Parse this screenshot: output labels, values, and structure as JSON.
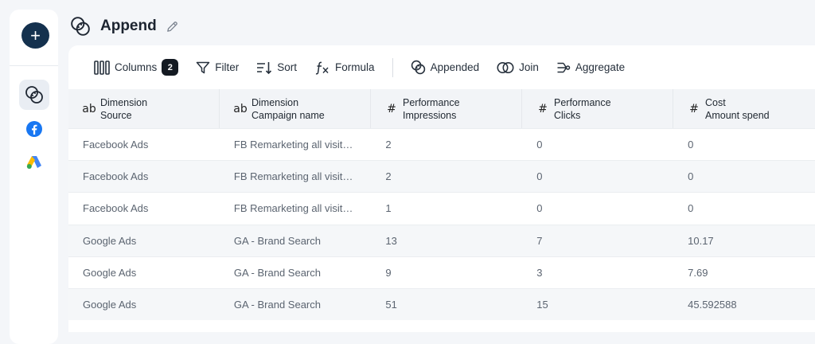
{
  "sidebar": {
    "add_label": "+",
    "items": [
      {
        "name": "sidebar-item-append",
        "icon": "append-chain-icon",
        "active": true
      },
      {
        "name": "sidebar-item-facebook",
        "icon": "facebook-icon",
        "active": false
      },
      {
        "name": "sidebar-item-google-ads",
        "icon": "google-ads-icon",
        "active": false
      }
    ]
  },
  "header": {
    "title": "Append",
    "icon": "append-chain-icon",
    "edit_icon": "pencil-icon"
  },
  "toolbar": {
    "columns_label": "Columns",
    "columns_count": "2",
    "filter_label": "Filter",
    "sort_label": "Sort",
    "formula_label": "Formula",
    "appended_label": "Appended",
    "join_label": "Join",
    "aggregate_label": "Aggregate"
  },
  "table": {
    "columns": [
      {
        "type_icon": "ab",
        "group": "Dimension",
        "name": "Source"
      },
      {
        "type_icon": "ab",
        "group": "Dimension",
        "name": "Campaign name"
      },
      {
        "type_icon": "#",
        "group": "Performance",
        "name": "Impressions"
      },
      {
        "type_icon": "#",
        "group": "Performance",
        "name": "Clicks"
      },
      {
        "type_icon": "#",
        "group": "Cost",
        "name": "Amount spend"
      }
    ],
    "rows": [
      [
        "Facebook Ads",
        "FB Remarketing all visitors",
        "2",
        "0",
        "0"
      ],
      [
        "Facebook Ads",
        "FB Remarketing all visitors",
        "2",
        "0",
        "0"
      ],
      [
        "Facebook Ads",
        "FB Remarketing all visitors",
        "1",
        "0",
        "0"
      ],
      [
        "Google Ads",
        "GA - Brand Search",
        "13",
        "7",
        "10.17"
      ],
      [
        "Google Ads",
        "GA - Brand Search",
        "9",
        "3",
        "7.69"
      ],
      [
        "Google Ads",
        "GA - Brand Search",
        "51",
        "15",
        "45.592588"
      ]
    ]
  },
  "colors": {
    "brand_dark": "#14314e",
    "facebook": "#1877f2",
    "google_blue": "#4285f4",
    "google_yellow": "#fbbc04",
    "google_green": "#34a853"
  }
}
